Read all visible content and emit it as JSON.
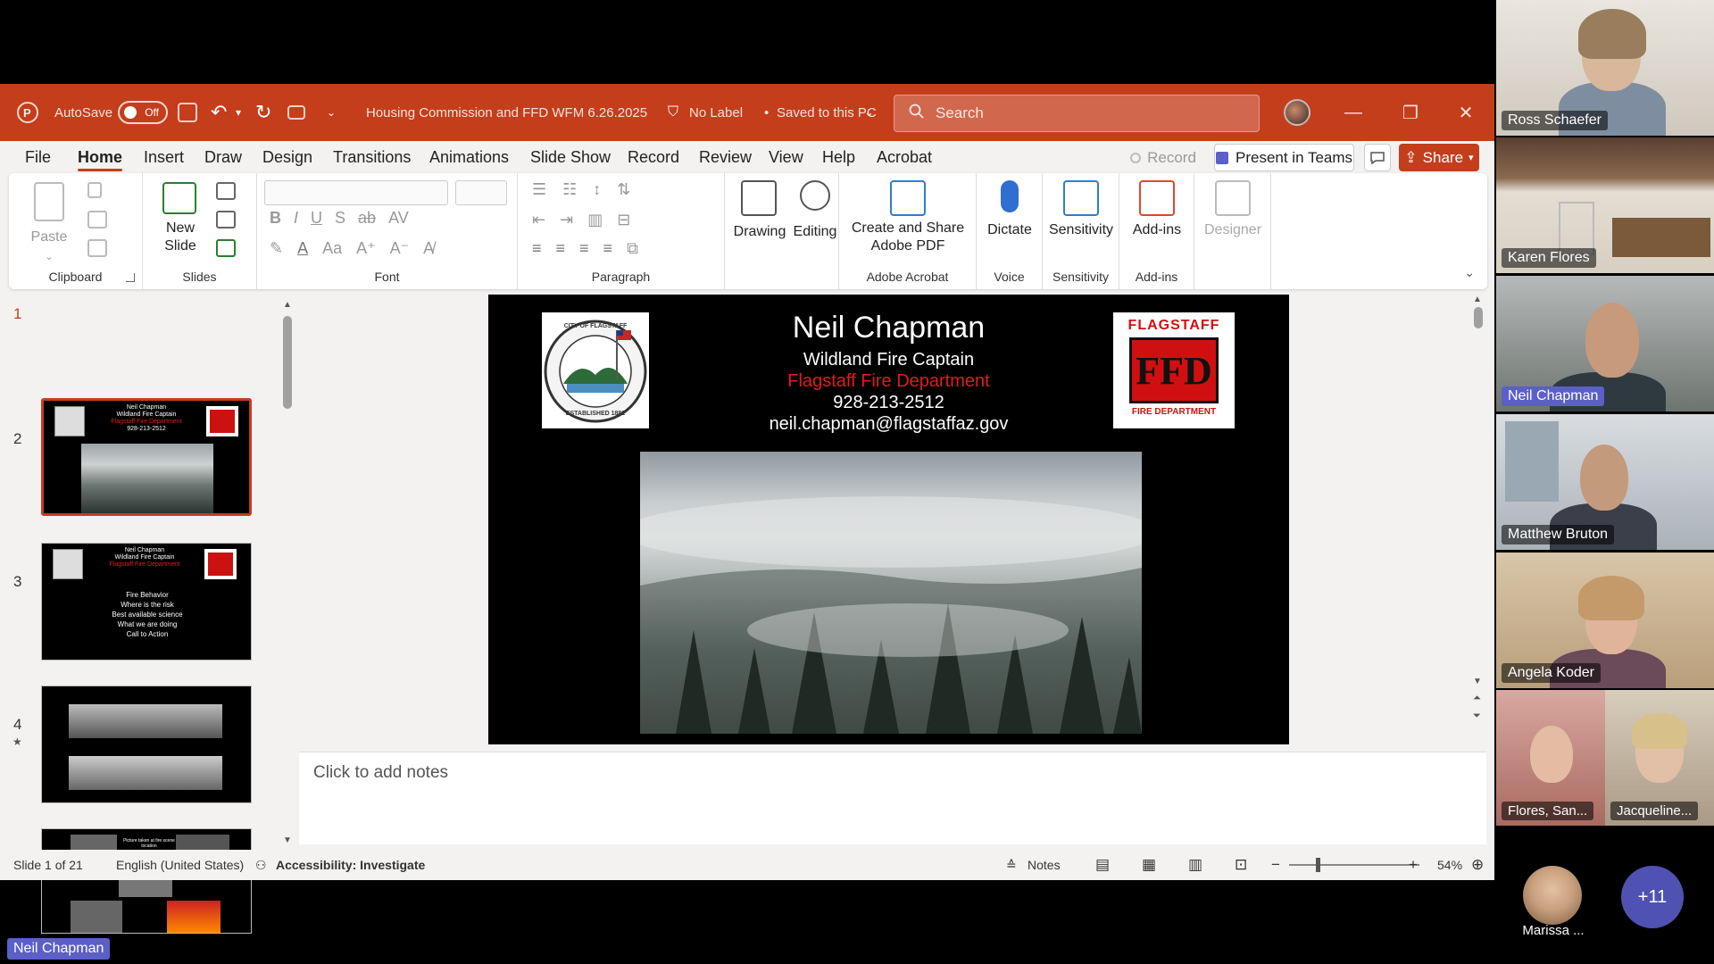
{
  "titlebar": {
    "autosave_label": "AutoSave",
    "autosave_state": "Off",
    "document_title": "Housing Commission and FFD WFM 6.26.2025",
    "label_status": "No Label",
    "save_status": "Saved to this PC",
    "search_placeholder": "Search",
    "accent_color": "#c43e1c"
  },
  "menu": {
    "tabs": [
      "File",
      "Home",
      "Insert",
      "Draw",
      "Design",
      "Transitions",
      "Animations",
      "Slide Show",
      "Record",
      "Review",
      "View",
      "Help",
      "Acrobat"
    ],
    "active_tab": "Home",
    "record_label": "Record",
    "present_teams_label": "Present in Teams",
    "share_label": "Share"
  },
  "ribbon": {
    "clipboard": {
      "paste": "Paste",
      "group": "Clipboard"
    },
    "slides": {
      "new_slide": "New",
      "new_slide2": "Slide",
      "group": "Slides"
    },
    "font": {
      "group": "Font"
    },
    "paragraph": {
      "group": "Paragraph"
    },
    "drawing": {
      "label": "Drawing"
    },
    "editing": {
      "label": "Editing"
    },
    "adobe": {
      "label1": "Create and Share",
      "label2": "Adobe PDF",
      "group": "Adobe Acrobat"
    },
    "voice": {
      "label": "Dictate",
      "group": "Voice"
    },
    "sensitivity": {
      "label": "Sensitivity",
      "group": "Sensitivity"
    },
    "addins": {
      "label": "Add-ins",
      "group": "Add-ins"
    },
    "designer": {
      "label": "Designer"
    }
  },
  "thumbnails": [
    {
      "number": "1",
      "selected": true
    },
    {
      "number": "2",
      "lines": [
        "Fire Behavior",
        "Where is the risk",
        "Best available science",
        "What we are doing",
        "Call to Action"
      ]
    },
    {
      "number": "3"
    },
    {
      "number": "4",
      "caption": "Picture taken at fire scene location"
    }
  ],
  "slide": {
    "name": "Neil Chapman",
    "title": "Wildland Fire Captain",
    "department": "Flagstaff Fire Department",
    "phone": "928-213-2512",
    "email": "neil.chapman@flagstaffaz.gov",
    "left_seal_top": "CITY OF FLAGSTAFF",
    "left_seal_right": "ARIZONA",
    "left_seal_bottom": "ESTABLISHED 1882",
    "right_logo_top": "FLAGSTAFF",
    "right_logo_mid": "FFD",
    "right_logo_bottom": "FIRE DEPARTMENT",
    "dept_color": "#e31b1b"
  },
  "notes": {
    "placeholder": "Click to add notes"
  },
  "status": {
    "slide_counter": "Slide 1 of 21",
    "language": "English (United States)",
    "accessibility": "Accessibility: Investigate",
    "notes_label": "Notes",
    "zoom": "54%"
  },
  "participants": [
    {
      "name": "Ross Schaefer"
    },
    {
      "name": "Karen Flores"
    },
    {
      "name": "Neil Chapman"
    },
    {
      "name": "Matthew Bruton"
    },
    {
      "name": "Angela Koder"
    },
    {
      "name": "Flores, San..."
    },
    {
      "name": "Jacqueline..."
    },
    {
      "name": "Marissa ..."
    }
  ],
  "more_participants": "+11",
  "presenter_label": "Neil Chapman"
}
